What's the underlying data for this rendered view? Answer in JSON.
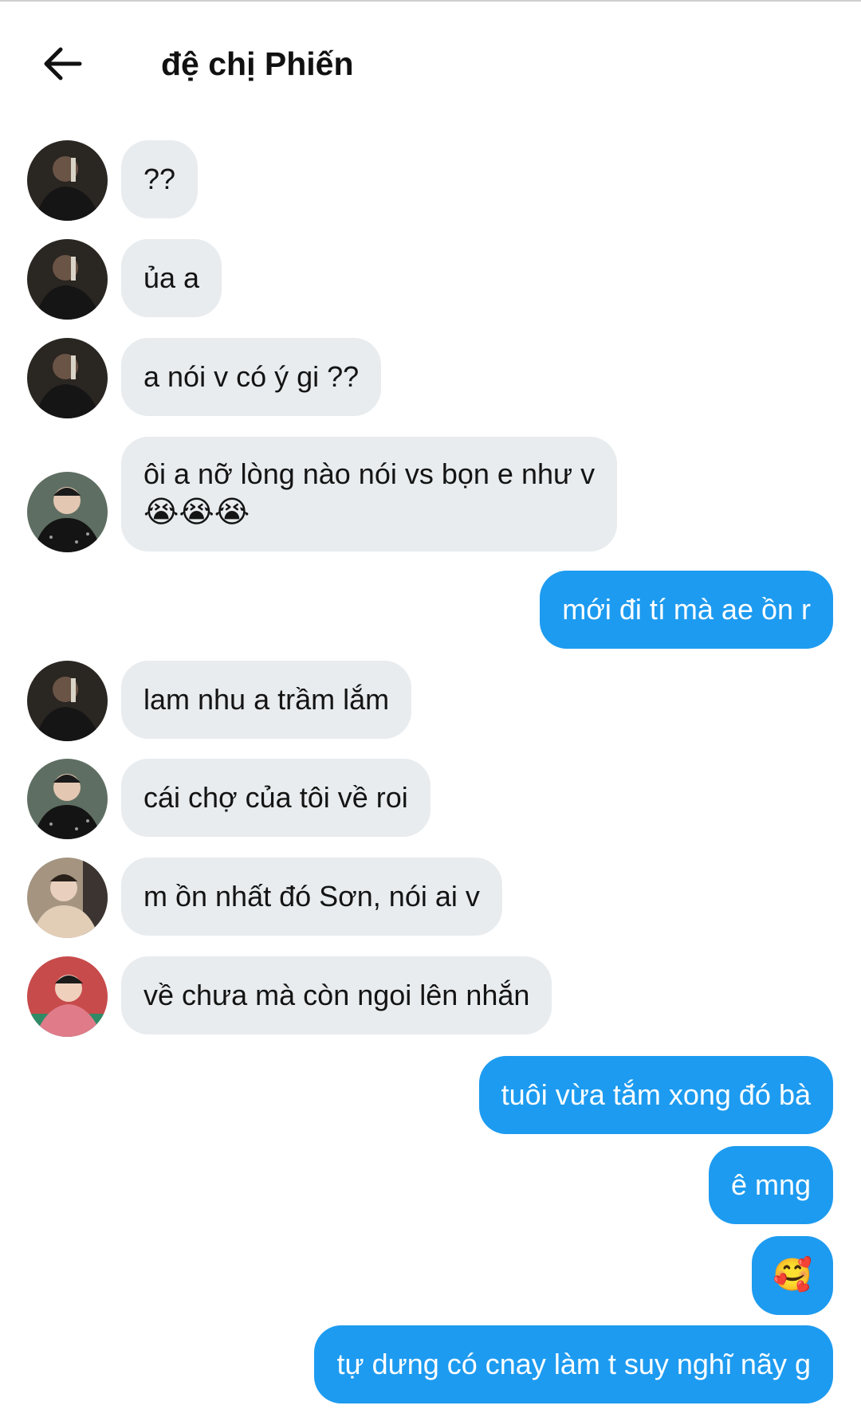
{
  "header": {
    "title": "đệ chị Phiến",
    "back_icon": "arrow-left-icon"
  },
  "colors": {
    "incoming_bubble": "#e8ecef",
    "outgoing_bubble": "#1d9bf0",
    "outgoing_text": "#ffffff"
  },
  "messages": [
    {
      "side": "in",
      "avatar": "avatar-man-dark-suit",
      "text": "??"
    },
    {
      "side": "in",
      "avatar": "avatar-man-dark-suit",
      "text": "ủa a"
    },
    {
      "side": "in",
      "avatar": "avatar-man-dark-suit",
      "text": "a nói v có ý gi ??"
    },
    {
      "side": "in",
      "avatar": "avatar-man-sparkle-jacket",
      "text": "ôi a nỡ lòng nào nói vs bọn e như v",
      "emoji": "😭😭😭"
    },
    {
      "side": "out",
      "text": "mới đi tí mà ae ồn r"
    },
    {
      "side": "in",
      "avatar": "avatar-man-dark-suit",
      "text": "lam nhu a trầm lắm"
    },
    {
      "side": "in",
      "avatar": "avatar-man-sparkle-jacket",
      "text": "cái chợ của tôi về roi"
    },
    {
      "side": "in",
      "avatar": "avatar-man-beige-jacket",
      "text": "m ồn nhất đó Sơn, nói ai v"
    },
    {
      "side": "in",
      "avatar": "avatar-man-red-background",
      "text": "về chưa mà còn ngoi lên nhắn"
    },
    {
      "side": "out",
      "text": "tuôi vừa tắm xong đó bà"
    },
    {
      "side": "out",
      "text": "ê mng"
    },
    {
      "side": "out",
      "text": "🥰"
    },
    {
      "side": "out",
      "text": "tự dưng có cnay làm t suy nghĩ nãy g"
    }
  ]
}
